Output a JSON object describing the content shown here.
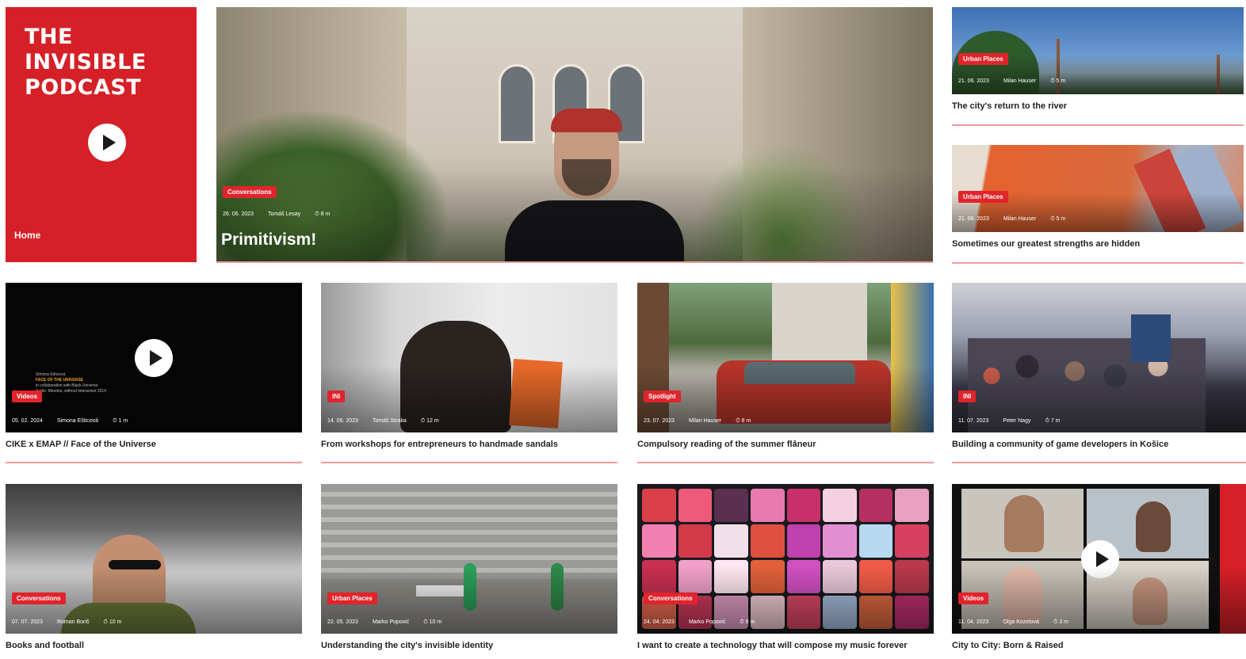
{
  "podcast": {
    "logo_lines": [
      "THE",
      "INVISIBLE",
      "PODCAST"
    ],
    "home_label": "Home"
  },
  "hero": {
    "tag": "Conversations",
    "date": "26. 06. 2023",
    "author": "Tomáš Lesay",
    "read_time": "8 m",
    "title": "Primitivism!"
  },
  "side_articles": [
    {
      "tag": "Urban Places",
      "date": "21. 06. 2023",
      "author": "Milan Hauser",
      "read_time": "5 m",
      "title": "The city's return to the river"
    },
    {
      "tag": "Urban Places",
      "date": "21. 06. 2023",
      "author": "Milan Hauser",
      "read_time": "5 m",
      "title": "Sometimes our greatest strengths are hidden"
    }
  ],
  "video_card": {
    "mini_lines": [
      "Simona Ešticová",
      "FACE OF THE UNIVERSE",
      "in collaboration with Black Universe",
      "Audio: Mendes, without interaction 2014"
    ]
  },
  "grid_articles": [
    {
      "tag": "Videos",
      "date": "05. 02. 2024",
      "author": "Simona Ešticová",
      "read_time": "1 m",
      "title": "CIKE x EMAP // Face of the Universe"
    },
    {
      "tag": "INI",
      "date": "14. 06. 2023",
      "author": "Tomáš Straka",
      "read_time": "12 m",
      "title": "From workshops for entrepreneurs to handmade sandals"
    },
    {
      "tag": "Spotlight",
      "date": "23. 07. 2023",
      "author": "Milan Hauser",
      "read_time": "8 m",
      "title": "Compulsory reading of the summer flâneur"
    },
    {
      "tag": "INI",
      "date": "11. 07. 2023",
      "author": "Peter Nagy",
      "read_time": "7 m",
      "title": "Building a community of game developers in Košice"
    },
    {
      "tag": "Conversations",
      "date": "07. 07. 2023",
      "author": "Roman Boriš",
      "read_time": "10 m",
      "title": "Books and football"
    },
    {
      "tag": "Urban Places",
      "date": "22. 05. 2023",
      "author": "Marko Popović",
      "read_time": "10 m",
      "title": "Understanding the city's invisible identity"
    },
    {
      "tag": "Conversations",
      "date": "24. 04. 2023",
      "author": "Marko Popović",
      "read_time": "9 m",
      "title": "I want to create a technology that will compose my music forever"
    },
    {
      "tag": "Videos",
      "date": "11. 04. 2023",
      "author": "Olga Kozelová",
      "read_time": "3 m",
      "title": "City to City: Born & Raised"
    }
  ],
  "colors": {
    "brand_red": "#d52027",
    "tag_red": "#e1242b",
    "rule_pink": "#f29b9e"
  }
}
